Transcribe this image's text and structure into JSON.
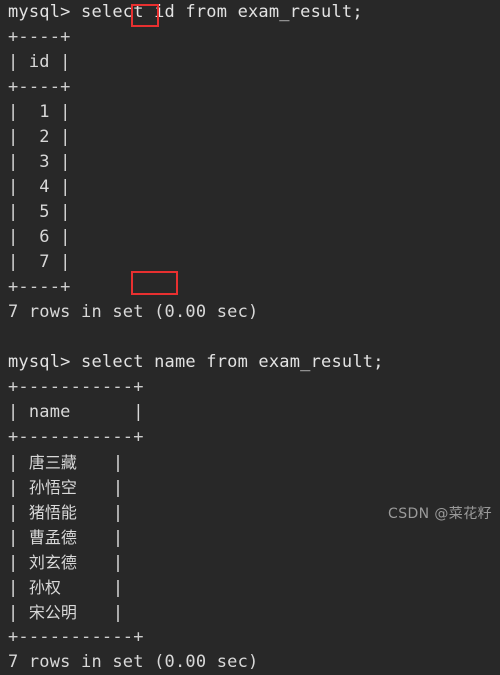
{
  "terminal": {
    "background_color": "#282828",
    "foreground_color": "#d8d8d8",
    "highlight_color": "#e83030",
    "lines": [
      "mysql> select id from exam_result;",
      "+----+",
      "| id |",
      "+----+",
      "|  1 |",
      "|  2 |",
      "|  3 |",
      "|  4 |",
      "|  5 |",
      "|  6 |",
      "|  7 |",
      "+----+",
      "7 rows in set (0.00 sec)",
      "",
      "mysql> select name from exam_result;",
      "+-----------+",
      "| name      |",
      "+-----------+"
    ],
    "name_rows": [
      "唐三藏",
      "孙悟空",
      "猪悟能",
      "曹孟德",
      "刘玄德",
      "孙权",
      "宋公明"
    ],
    "name_row_prefix": "| ",
    "name_row_suffix": "|",
    "footer_lines": [
      "+-----------+",
      "7 rows in set (0.00 sec)"
    ]
  },
  "queries": [
    {
      "prompt": "mysql>",
      "sql": "select id from exam_result;",
      "highlighted_column": "id",
      "result_rows": [
        "1",
        "2",
        "3",
        "4",
        "5",
        "6",
        "7"
      ],
      "result_header": "id",
      "status": "7 rows in set (0.00 sec)"
    },
    {
      "prompt": "mysql>",
      "sql": "select name from exam_result;",
      "highlighted_column": "name",
      "result_rows": [
        "唐三藏",
        "孙悟空",
        "猪悟能",
        "曹孟德",
        "刘玄德",
        "孙权",
        "宋公明"
      ],
      "result_header": "name",
      "status": "7 rows in set (0.00 sec)"
    }
  ],
  "watermark": {
    "text": "CSDN @菜花籽"
  }
}
